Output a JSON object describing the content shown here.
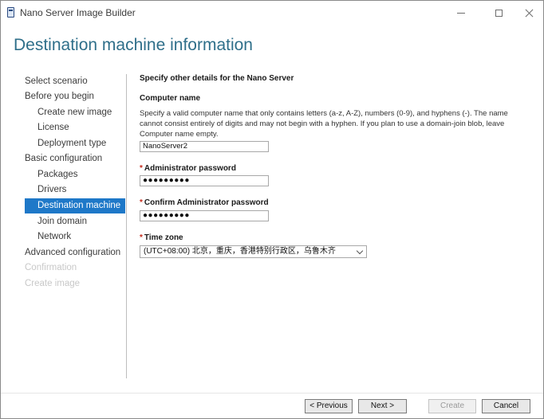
{
  "window": {
    "title": "Nano Server Image Builder"
  },
  "page": {
    "title": "Destination machine information"
  },
  "nav": {
    "items": [
      {
        "label": "Select scenario",
        "level": 0,
        "state": "normal"
      },
      {
        "label": "Before you begin",
        "level": 0,
        "state": "normal"
      },
      {
        "label": "Create new image",
        "level": 1,
        "state": "normal"
      },
      {
        "label": "License",
        "level": 1,
        "state": "normal"
      },
      {
        "label": "Deployment type",
        "level": 1,
        "state": "normal"
      },
      {
        "label": "Basic configuration",
        "level": 0,
        "state": "normal"
      },
      {
        "label": "Packages",
        "level": 1,
        "state": "normal"
      },
      {
        "label": "Drivers",
        "level": 1,
        "state": "normal"
      },
      {
        "label": "Destination machine",
        "level": 1,
        "state": "selected"
      },
      {
        "label": "Join domain",
        "level": 1,
        "state": "normal"
      },
      {
        "label": "Network",
        "level": 1,
        "state": "normal"
      },
      {
        "label": "Advanced configuration",
        "level": 0,
        "state": "normal"
      },
      {
        "label": "Confirmation",
        "level": 0,
        "state": "disabled"
      },
      {
        "label": "Create image",
        "level": 0,
        "state": "disabled"
      }
    ]
  },
  "form": {
    "section_title": "Specify other details for the Nano Server",
    "computer_name": {
      "label": "Computer name",
      "description": "Specify a valid computer name that only contains letters (a-z, A-Z), numbers (0-9), and hyphens (-). The name cannot consist entirely of digits and may not begin with a hyphen. If you plan to use a domain-join blob, leave Computer name empty.",
      "value": "NanoServer2"
    },
    "admin_password": {
      "required_mark": "*",
      "label": "Administrator password",
      "masked_value": "●●●●●●●●●"
    },
    "confirm_password": {
      "required_mark": "*",
      "label": "Confirm Administrator password",
      "masked_value": "●●●●●●●●●"
    },
    "time_zone": {
      "required_mark": "*",
      "label": "Time zone",
      "selected": "(UTC+08:00) 北京，重庆，香港特别行政区，乌鲁木齐"
    }
  },
  "buttons": {
    "previous": "< Previous",
    "next": "Next >",
    "create": "Create",
    "cancel": "Cancel"
  },
  "colors": {
    "title_accent": "#2f6f8a",
    "nav_selected": "#1e78c8",
    "required": "#c42b1c"
  }
}
